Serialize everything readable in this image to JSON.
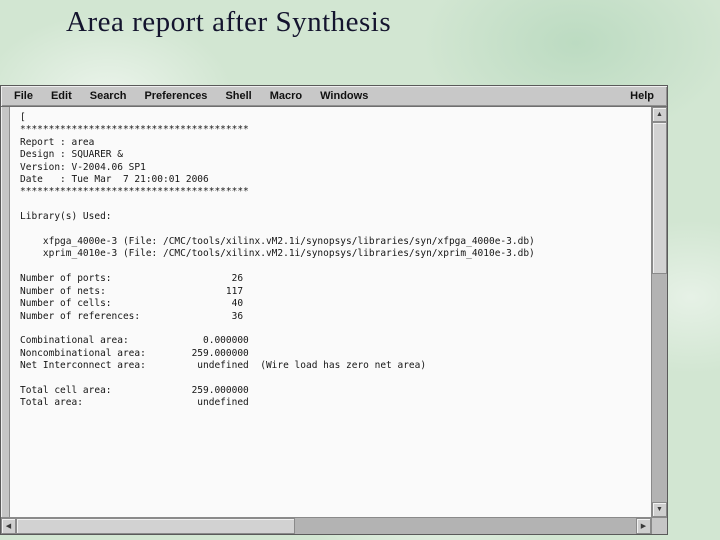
{
  "slide": {
    "title": "Area report after Synthesis"
  },
  "window": {
    "menu": [
      "File",
      "Edit",
      "Search",
      "Preferences",
      "Shell",
      "Macro",
      "Windows"
    ],
    "help_label": "Help",
    "report_lines": [
      "[",
      "****************************************",
      "Report : area",
      "Design : SQUARER &",
      "Version: V-2004.06 SP1",
      "Date   : Tue Mar  7 21:00:01 2006",
      "****************************************",
      "",
      "Library(s) Used:",
      "",
      "    xfpga_4000e-3 (File: /CMC/tools/xilinx.vM2.1i/synopsys/libraries/syn/xfpga_4000e-3.db)",
      "    xprim_4010e-3 (File: /CMC/tools/xilinx.vM2.1i/synopsys/libraries/syn/xprim_4010e-3.db)",
      "",
      "Number of ports:                     26",
      "Number of nets:                     117",
      "Number of cells:                     40",
      "Number of references:                36",
      "",
      "Combinational area:             0.000000",
      "Noncombinational area:        259.000000",
      "Net Interconnect area:         undefined  (Wire load has zero net area)",
      "",
      "Total cell area:              259.000000",
      "Total area:                    undefined"
    ],
    "scrollbar": {
      "up": "▲",
      "down": "▼",
      "left": "◀",
      "right": "▶"
    }
  }
}
